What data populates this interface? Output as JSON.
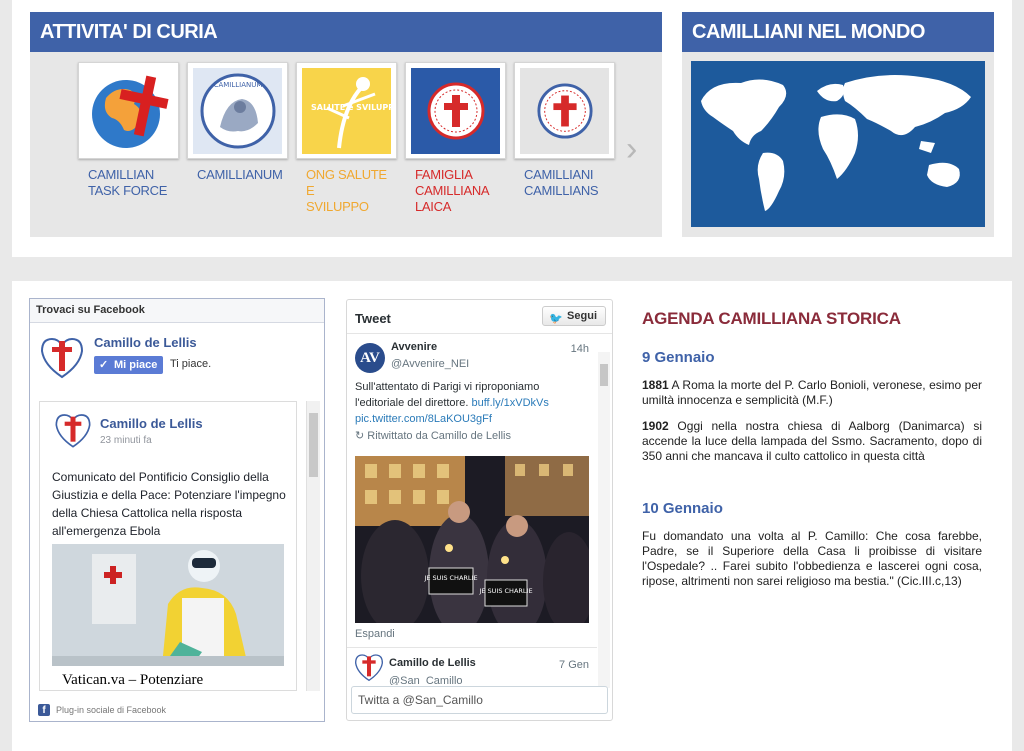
{
  "curia": {
    "title": "ATTIVITA' DI CURIA",
    "items": [
      {
        "label": "CAMILLIAN\nTASK FORCE",
        "color": "#3f62a8"
      },
      {
        "label": "CAMILLIANUM",
        "color": "#3f62a8"
      },
      {
        "label": "ONG SALUTE e\nSVILUPPO",
        "color": "#f0a830"
      },
      {
        "label": "FAMIGLIA\nCAMILLIANA LAICA",
        "color": "#d62a2a"
      },
      {
        "label": "CAMILLIANI\nCAMILLIANS",
        "color": "#3f62a8"
      }
    ],
    "camillianum_logo_text": "CAMILLIANUM",
    "salute_logo_text": "SALUTE e SVILUPPO"
  },
  "mondo": {
    "title": "CAMILLIANI NEL MONDO"
  },
  "facebook": {
    "header": "Trovaci su Facebook",
    "page_name": "Camillo de Lellis",
    "like_button": "Mi piace",
    "like_text": "Ti piace.",
    "post": {
      "author": "Camillo de Lellis",
      "time": "23 minuti fa",
      "text": "Comunicato del Pontificio Consiglio della Giustizia e della Pace: Potenziare l'impegno della Chiesa Cattolica nella risposta all'emergenza Ebola",
      "link_title": "Vatican.va – Potenziare"
    },
    "footer": "Plug-in sociale di Facebook"
  },
  "twitter": {
    "title": "Tweet",
    "follow_button": "Segui",
    "tweet1": {
      "name": "Avvenire",
      "handle": "@Avvenire_NEI",
      "avatar_text": "AV",
      "time": "14h",
      "text": "Sull'attentato di Parigi vi riproponiamo l'editoriale del direttore. ",
      "link1": "buff.ly/1xVDkVs",
      "link2": "pic.twitter.com/8LaKOU3gFf",
      "retweet": "Ritwittato da Camillo de Lellis",
      "photo_sign1": "JE SUIS CHARLIE",
      "photo_sign2": "JE SUIS CHARLIE",
      "expand": "Espandi"
    },
    "tweet2": {
      "name": "Camillo de Lellis",
      "handle": "@San_Camillo",
      "time": "7 Gen"
    },
    "compose_placeholder": "Twitta a @San_Camillo"
  },
  "agenda": {
    "title": "AGENDA CAMILLIANA STORICA",
    "days": [
      {
        "date": "9 Gennaio",
        "entries": [
          {
            "year": "1881",
            "text": " A Roma la morte del P. Carlo Bonioli, veronese, esimo per umiltà innocenza e semplicità (M.F.)"
          },
          {
            "year": "1902",
            "text": " Oggi nella nostra chiesa di Aalborg (Danimarca) si accende la luce della lampada del Ssmo. Sacramento, dopo di 350 anni che mancava il culto cattolico in questa città"
          }
        ]
      },
      {
        "date": "10 Gennaio",
        "text": "Fu domandato una volta al P. Camillo: Che cosa farebbe, Padre, se il Superiore della Casa li proibisse di visitare l'Ospedale? .. Farei subito l'obbedienza e lascerei ogni cosa, ripose, altrimenti non sarei religioso ma bestia.\" (Cic.III.c,13)"
      }
    ]
  },
  "colors": {
    "brand_blue": "#3f62a8",
    "agenda_red": "#8a2b3a",
    "facebook": "#3b5998",
    "twitter_link": "#2b7bb9"
  }
}
